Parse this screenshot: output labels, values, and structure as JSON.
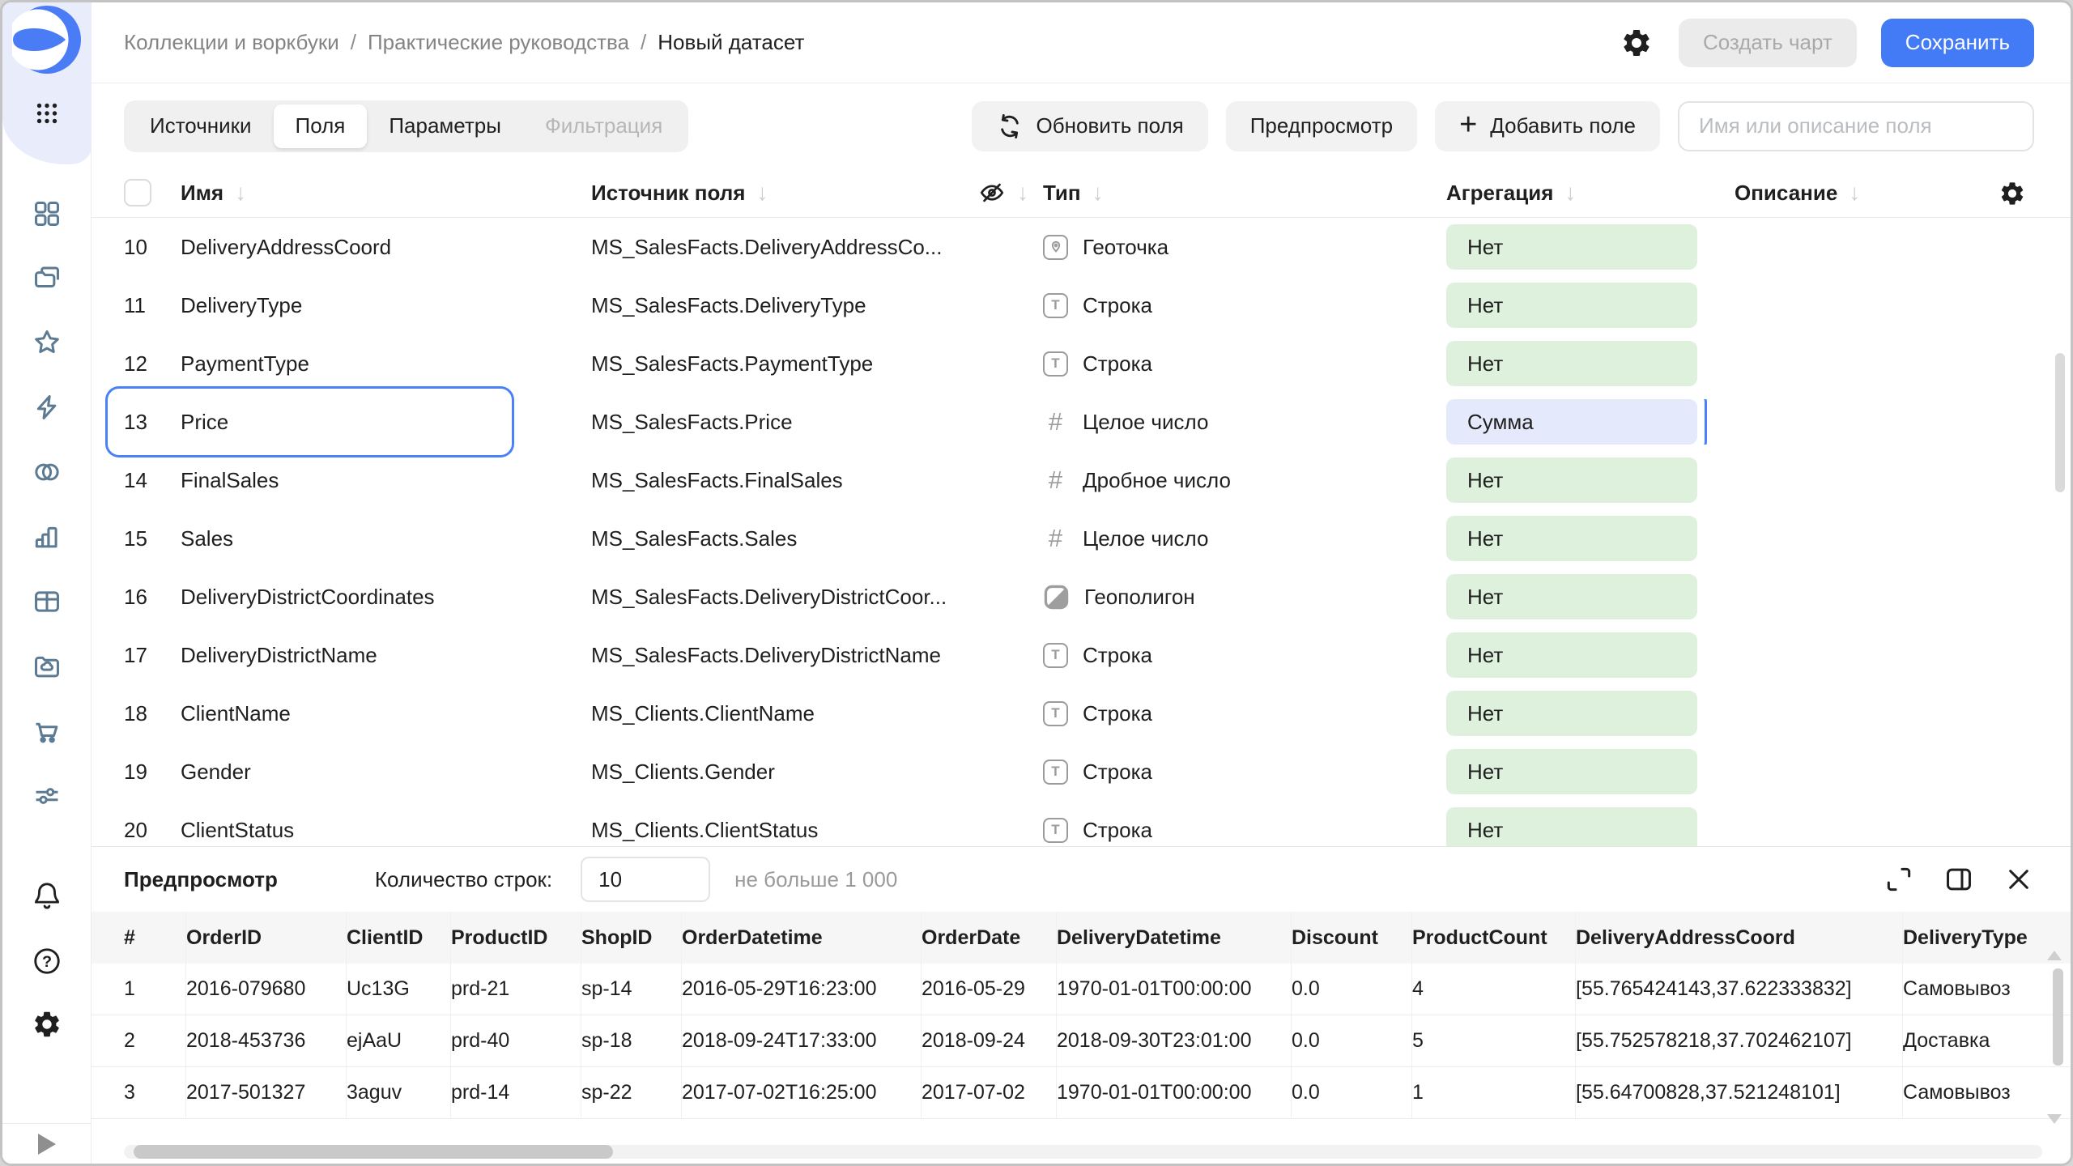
{
  "topbar": {
    "breadcrumbs": [
      "Коллекции и воркбуки",
      "Практические руководства",
      "Новый датасет"
    ],
    "create_chart_label": "Создать чарт",
    "save_label": "Сохранить"
  },
  "toolbar": {
    "tabs": [
      {
        "key": "sources",
        "label": "Источники",
        "state": "normal"
      },
      {
        "key": "fields",
        "label": "Поля",
        "state": "active"
      },
      {
        "key": "parameters",
        "label": "Параметры",
        "state": "normal"
      },
      {
        "key": "filtering",
        "label": "Фильтрация",
        "state": "disabled"
      }
    ],
    "refresh_label": "Обновить поля",
    "preview_label": "Предпросмотр",
    "add_field_label": "Добавить поле",
    "search_placeholder": "Имя или описание поля"
  },
  "icons": {
    "sort_arrow": "↓",
    "plus": "+"
  },
  "fields_table": {
    "headers": {
      "name": "Имя",
      "source": "Источник поля",
      "type": "Тип",
      "aggregation": "Агрегация",
      "description": "Описание"
    },
    "rows": [
      {
        "index": "10",
        "name": "DeliveryAddressCoord",
        "source": "MS_SalesFacts.DeliveryAddressCo...",
        "type": "Геоточка",
        "type_icon": "geopoint",
        "aggregation": "Нет",
        "selected": false
      },
      {
        "index": "11",
        "name": "DeliveryType",
        "source": "MS_SalesFacts.DeliveryType",
        "type": "Строка",
        "type_icon": "string",
        "aggregation": "Нет",
        "selected": false
      },
      {
        "index": "12",
        "name": "PaymentType",
        "source": "MS_SalesFacts.PaymentType",
        "type": "Строка",
        "type_icon": "string",
        "aggregation": "Нет",
        "selected": false
      },
      {
        "index": "13",
        "name": "Price",
        "source": "MS_SalesFacts.Price",
        "type": "Целое число",
        "type_icon": "number",
        "aggregation": "Сумма",
        "selected": true
      },
      {
        "index": "14",
        "name": "FinalSales",
        "source": "MS_SalesFacts.FinalSales",
        "type": "Дробное число",
        "type_icon": "number",
        "aggregation": "Нет",
        "selected": false
      },
      {
        "index": "15",
        "name": "Sales",
        "source": "MS_SalesFacts.Sales",
        "type": "Целое число",
        "type_icon": "number",
        "aggregation": "Нет",
        "selected": false
      },
      {
        "index": "16",
        "name": "DeliveryDistrictCoordinates",
        "source": "MS_SalesFacts.DeliveryDistrictCoor...",
        "type": "Геополигон",
        "type_icon": "geopolygon",
        "aggregation": "Нет",
        "selected": false
      },
      {
        "index": "17",
        "name": "DeliveryDistrictName",
        "source": "MS_SalesFacts.DeliveryDistrictName",
        "type": "Строка",
        "type_icon": "string",
        "aggregation": "Нет",
        "selected": false
      },
      {
        "index": "18",
        "name": "ClientName",
        "source": "MS_Clients.ClientName",
        "type": "Строка",
        "type_icon": "string",
        "aggregation": "Нет",
        "selected": false
      },
      {
        "index": "19",
        "name": "Gender",
        "source": "MS_Clients.Gender",
        "type": "Строка",
        "type_icon": "string",
        "aggregation": "Нет",
        "selected": false
      },
      {
        "index": "20",
        "name": "ClientStatus",
        "source": "MS_Clients.ClientStatus",
        "type": "Строка",
        "type_icon": "string",
        "aggregation": "Нет",
        "selected": false
      }
    ]
  },
  "preview_panel": {
    "title": "Предпросмотр",
    "rows_count_label": "Количество строк:",
    "rows_count_value": "10",
    "rows_count_hint": "не больше 1 000",
    "table": {
      "headers": [
        "#",
        "OrderID",
        "ClientID",
        "ProductID",
        "ShopID",
        "OrderDatetime",
        "OrderDate",
        "DeliveryDatetime",
        "Discount",
        "ProductCount",
        "DeliveryAddressCoord",
        "DeliveryType"
      ],
      "rows": [
        [
          "1",
          "2016-079680",
          "Uc13G",
          "prd-21",
          "sp-14",
          "2016-05-29T16:23:00",
          "2016-05-29",
          "1970-01-01T00:00:00",
          "0.0",
          "4",
          "[55.765424143,37.622333832]",
          "Самовывоз"
        ],
        [
          "2",
          "2018-453736",
          "ejAaU",
          "prd-40",
          "sp-18",
          "2018-09-24T17:33:00",
          "2018-09-24",
          "2018-09-30T23:01:00",
          "0.0",
          "5",
          "[55.752578218,37.702462107]",
          "Доставка"
        ],
        [
          "3",
          "2017-501327",
          "3aguv",
          "prd-14",
          "sp-22",
          "2017-07-02T16:25:00",
          "2017-07-02",
          "1970-01-01T00:00:00",
          "0.0",
          "1",
          "[55.64700828,37.521248101]",
          "Самовывоз"
        ]
      ]
    }
  },
  "colors": {
    "accent_blue": "#437af5",
    "selection_outline": "#4a81f9",
    "aggregation_pill_green": "#def1dc",
    "aggregation_pill_blue": "#e4e9fc",
    "sidebar_icon": "#5c7a92"
  }
}
